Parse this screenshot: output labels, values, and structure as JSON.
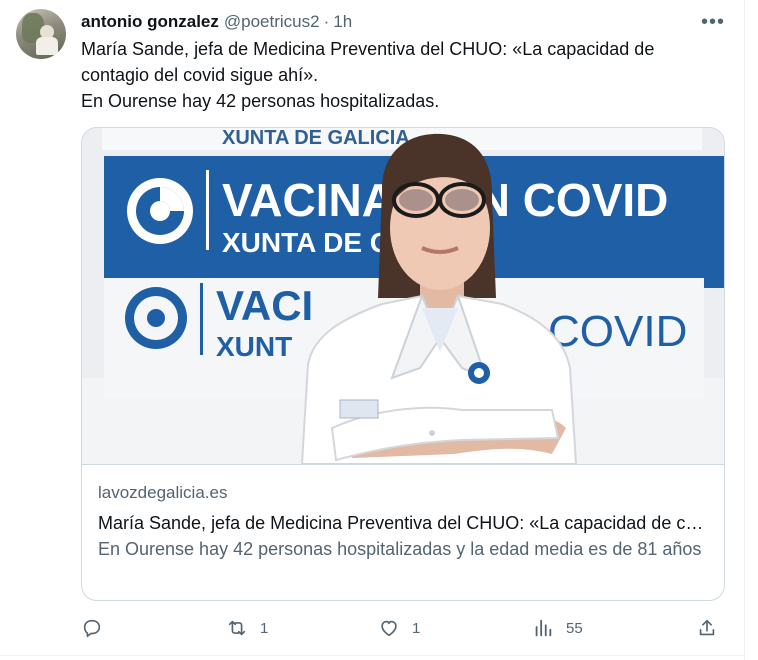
{
  "tweet": {
    "display_name": "antonio gonzalez",
    "handle": "@poetricus2",
    "separator": "·",
    "time": "1h",
    "more_label": "•••",
    "text_line1": "María Sande, jefa de Medicina Preventiva del CHUO: «La capacidad de contagio del covid sigue ahí».",
    "text_line2": "En Ourense hay 42 personas hospitalizadas."
  },
  "card": {
    "domain": "lavozdegalicia.es",
    "title": "María Sande, jefa de Medicina Preventiva del CHUO: «La capacidad de contagio del covid sigue ahí»",
    "description": "En Ourense hay 42 personas hospitalizadas y la edad media es de 81 años",
    "image_texts": {
      "top_banner": "XUNTA DE GALICIA",
      "banner_main": "VACINACIÓN COVID",
      "banner_sub": "XUNTA DE GALICIA",
      "lower_banner_left": "VACI",
      "lower_banner_right": "COVID",
      "lower_banner_sub": "XUNT"
    }
  },
  "actions": {
    "reply_count": "",
    "retweet_count": "1",
    "like_count": "1",
    "views_count": "55"
  },
  "icons": [
    "reply-icon",
    "retweet-icon",
    "like-icon",
    "views-icon",
    "share-icon",
    "more-icon"
  ],
  "colors": {
    "text": "#0f1419",
    "muted": "#536471",
    "border": "#cfd9de",
    "banner_blue": "#1f5fa6"
  }
}
